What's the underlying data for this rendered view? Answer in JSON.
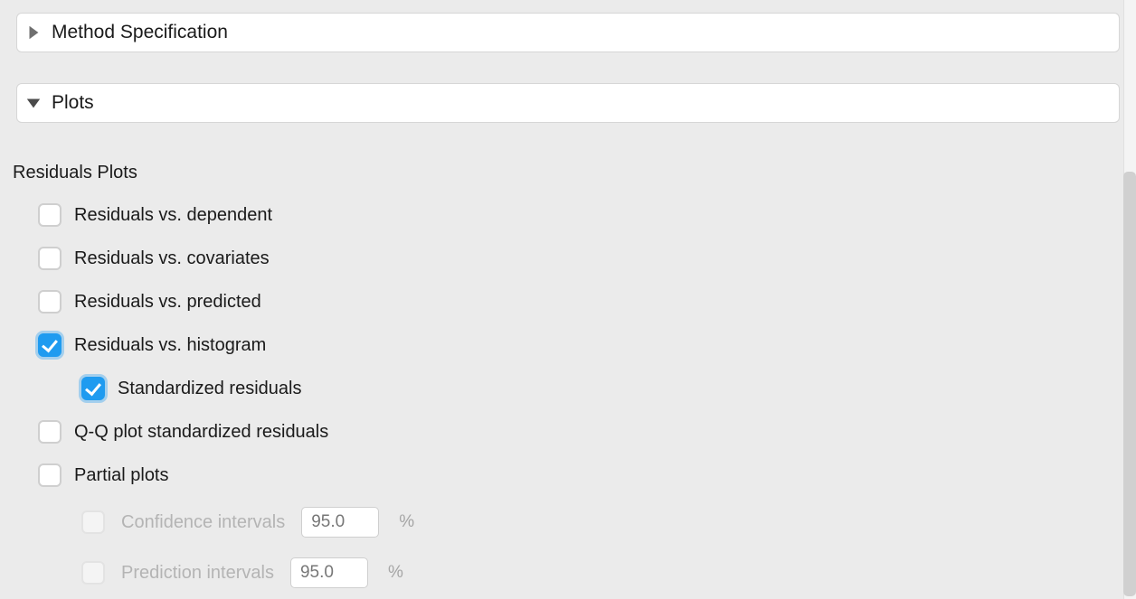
{
  "panels": {
    "method_spec": {
      "title": "Method Specification",
      "expanded": false
    },
    "plots": {
      "title": "Plots",
      "expanded": true
    }
  },
  "section": {
    "residuals_plots_label": "Residuals Plots"
  },
  "options": {
    "residuals_vs_dependent": {
      "label": "Residuals vs. dependent",
      "checked": false
    },
    "residuals_vs_covariates": {
      "label": "Residuals vs. covariates",
      "checked": false
    },
    "residuals_vs_predicted": {
      "label": "Residuals vs. predicted",
      "checked": false
    },
    "residuals_vs_histogram": {
      "label": "Residuals vs. histogram",
      "checked": true
    },
    "standardized_residuals": {
      "label": "Standardized residuals",
      "checked": true
    },
    "qq_plot": {
      "label": "Q-Q plot standardized residuals",
      "checked": false
    },
    "partial_plots": {
      "label": "Partial plots",
      "checked": false
    },
    "confidence_intervals": {
      "label": "Confidence intervals",
      "value": "95.0",
      "suffix": "%",
      "enabled": false
    },
    "prediction_intervals": {
      "label": "Prediction intervals",
      "value": "95.0",
      "suffix": "%",
      "enabled": false
    }
  }
}
